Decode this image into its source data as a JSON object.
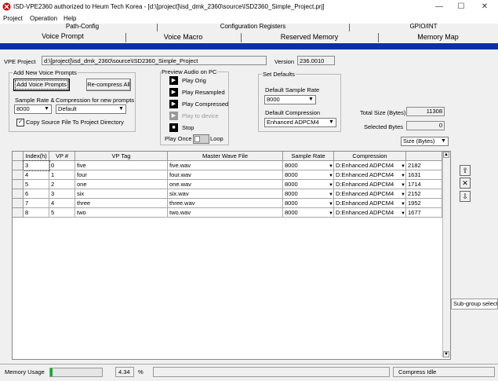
{
  "window": {
    "title": "ISD-VPE2360 authorized to Heum Tech Korea - [d:\\[project]\\isd_dmk_2360\\source\\ISD2360_Simple_Project.prj]",
    "minimize": "—",
    "maximize": "☐",
    "close": "✕"
  },
  "menu": {
    "items": [
      "Project",
      "Operation",
      "Help"
    ]
  },
  "tabs": {
    "back": [
      "Path-Config",
      "Configuration Registers",
      "GPIO/INT"
    ],
    "front": [
      "Voice Prompt",
      "Voice Macro",
      "Reserved Memory",
      "Memory Map"
    ]
  },
  "project": {
    "label": "VPE Project",
    "path": "d:\\[project]\\isd_dmk_2360\\source\\ISD2360_Simple_Project",
    "version_label": "Version",
    "version": "236.0010"
  },
  "add_group": {
    "legend": "Add New Voice Prompts",
    "add_button": "Add Voice Prompts",
    "recompress_button": "Re-compress All",
    "sample_rate_label": "Sample Rate &",
    "sample_rate_value": "8000",
    "compression_label": "Compression for new prompts",
    "compression_value": "Default",
    "copy_checkbox_label": "Copy Source File To Project Directory"
  },
  "preview_group": {
    "legend": "Preview Audio on PC",
    "play_orig": "Play Orig",
    "play_resampled": "Play Resampled",
    "play_compressed": "Play Compressed",
    "play_device": "Play to device",
    "stop": "Stop",
    "play_once": "Play Once",
    "loop": "Loop"
  },
  "defaults_group": {
    "legend": "Set Defaults",
    "sample_rate_label": "Default Sample Rate",
    "sample_rate_value": "8000",
    "compression_label": "Default Compression",
    "compression_value": "Enhanced ADPCM4"
  },
  "sizes": {
    "total_label": "Total Size (Bytes)",
    "total_value": "11308",
    "selected_label": "Selected Bytes",
    "selected_value": "0",
    "unit_select": "Size (Bytes)"
  },
  "grid": {
    "headers": [
      "Index(h)",
      "VP #",
      "VP Tag",
      "Master Wave File",
      "Sample Rate",
      "Compression",
      ""
    ],
    "rows": [
      [
        "3",
        "0",
        "five",
        "five.wav",
        "8000",
        "D:Enhanced ADPCM4",
        "2182"
      ],
      [
        "4",
        "1",
        "four",
        "four.wav",
        "8000",
        "D:Enhanced ADPCM4",
        "1631"
      ],
      [
        "5",
        "2",
        "one",
        "one.wav",
        "8000",
        "D:Enhanced ADPCM4",
        "1714"
      ],
      [
        "6",
        "3",
        "six",
        "six.wav",
        "8000",
        "D:Enhanced ADPCM4",
        "2152"
      ],
      [
        "7",
        "4",
        "three",
        "three.wav",
        "8000",
        "D:Enhanced ADPCM4",
        "1952"
      ],
      [
        "8",
        "5",
        "two",
        "two.wav",
        "8000",
        "D:Enhanced ADPCM4",
        "1677"
      ]
    ]
  },
  "side": {
    "subgroup_label": "Sub-group selecte"
  },
  "status": {
    "memory_label": "Memory Usage",
    "memory_value": "4.34",
    "memory_unit": "%",
    "memory_fraction": 0.0434,
    "compress_status": "Compress Idle"
  }
}
